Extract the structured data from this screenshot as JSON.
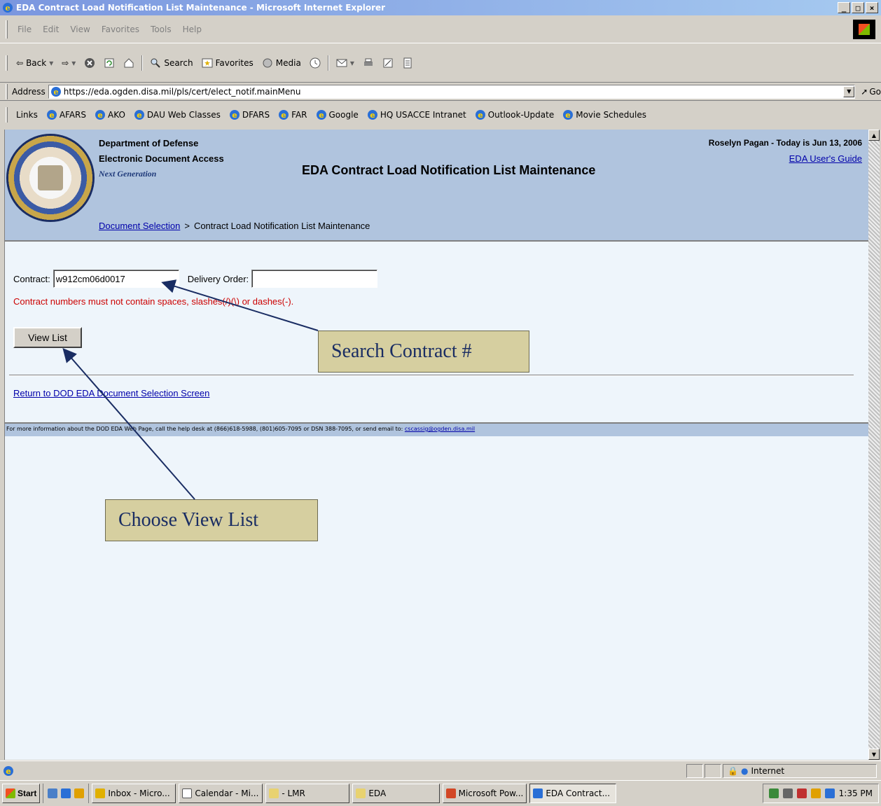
{
  "window": {
    "title": "EDA Contract Load Notification List Maintenance - Microsoft Internet Explorer"
  },
  "menu": [
    "File",
    "Edit",
    "View",
    "Favorites",
    "Tools",
    "Help"
  ],
  "toolbar": {
    "back": "Back",
    "search": "Search",
    "favorites": "Favorites",
    "media": "Media"
  },
  "address": {
    "label": "Address",
    "url": "https://eda.ogden.disa.mil/pls/cert/elect_notif.mainMenu",
    "go": "Go"
  },
  "links": {
    "label": "Links",
    "items": [
      "AFARS",
      "AKO",
      "DAU Web Classes",
      "DFARS",
      "FAR",
      "Google",
      "HQ USACCE Intranet",
      "Outlook-Update",
      "Movie Schedules"
    ]
  },
  "header": {
    "org_line1": "Department of Defense",
    "org_line2": "Electronic Document Access",
    "org_line3": "Next Generation",
    "title": "EDA Contract Load Notification List Maintenance",
    "user_line": "Roselyn Pagan - Today is Jun 13, 2006",
    "guide_link": "EDA User's Guide",
    "breadcrumb_link": "Document Selection",
    "breadcrumb_sep": ">",
    "breadcrumb_current": "Contract Load Notification List Maintenance"
  },
  "form": {
    "contract_label": "Contract:",
    "contract_value": "w912cm06d0017",
    "delivery_label": "Delivery Order:",
    "delivery_value": "",
    "error": "Contract numbers must not contain spaces, slashes(/)(\\) or dashes(-).",
    "view_button": "View List",
    "return_link": "Return to DOD EDA Document Selection Screen"
  },
  "footer": {
    "text": "For more information about the DOD EDA Web Page, call the help desk at (866)618-5988, (801)605-7095 or DSN 388-7095, or send email to: ",
    "email": "cscassig@ogden.disa.mil"
  },
  "callouts": {
    "search": "Search Contract #",
    "view": "Choose View List"
  },
  "status": {
    "zone": "Internet"
  },
  "taskbar": {
    "start": "Start",
    "tasks": [
      "Inbox - Micro...",
      "Calendar - Mi...",
      "- LMR",
      "EDA",
      "Microsoft Pow...",
      "EDA Contract..."
    ],
    "clock": "1:35 PM"
  },
  "colors": {
    "header_bg": "#b0c4de",
    "page_bg": "#eef5fb",
    "error": "#cc0000",
    "link": "#0000aa",
    "callout_bg": "#d6cfa0",
    "arrow": "#1a2d63"
  }
}
